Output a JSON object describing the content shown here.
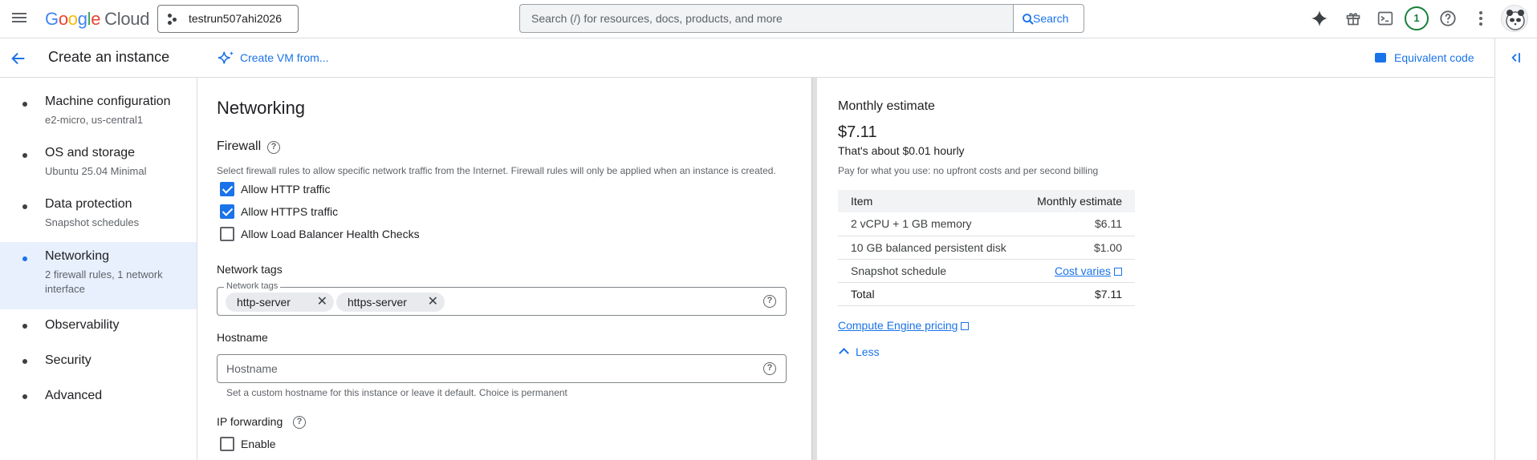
{
  "topbar": {
    "logo": {
      "g1": "G",
      "o1": "o",
      "o2": "o",
      "g2": "g",
      "l": "l",
      "e": "e",
      "cloud": "Cloud"
    },
    "project": "testrun507ahi2026",
    "search_placeholder": "Search (/) for resources, docs, products, and more",
    "search_button": "Search",
    "notification_count": "1",
    "icons": [
      "menu-icon",
      "gemini-spark-icon",
      "gift-icon",
      "cloud-shell-icon",
      "help-icon",
      "more-vert-icon"
    ]
  },
  "header": {
    "title": "Create an instance",
    "create_vm": "Create VM from...",
    "equivalent_code": "Equivalent code"
  },
  "nav": {
    "items": [
      {
        "title": "Machine configuration",
        "sub": "e2-micro, us-central1"
      },
      {
        "title": "OS and storage",
        "sub": "Ubuntu 25.04 Minimal"
      },
      {
        "title": "Data protection",
        "sub": "Snapshot schedules"
      },
      {
        "title": "Networking",
        "sub": "2 firewall rules, 1 network interface",
        "active": true
      },
      {
        "title": "Observability"
      },
      {
        "title": "Security"
      },
      {
        "title": "Advanced"
      }
    ]
  },
  "main": {
    "section_title": "Networking",
    "firewall": {
      "title": "Firewall",
      "description": "Select firewall rules to allow specific network traffic from the Internet. Firewall rules will only be applied when an instance is created.",
      "options": [
        {
          "label": "Allow HTTP traffic",
          "checked": true
        },
        {
          "label": "Allow HTTPS traffic",
          "checked": true
        },
        {
          "label": "Allow Load Balancer Health Checks",
          "checked": false
        }
      ]
    },
    "network_tags": {
      "title": "Network tags",
      "field_label": "Network tags",
      "chips": [
        "http-server",
        "https-server"
      ]
    },
    "hostname": {
      "title": "Hostname",
      "placeholder": "Hostname",
      "hint": "Set a custom hostname for this instance or leave it default. Choice is permanent"
    },
    "ip_forwarding": {
      "title": "IP forwarding",
      "option": {
        "label": "Enable",
        "checked": false
      }
    }
  },
  "estimate": {
    "title": "Monthly estimate",
    "price": "$7.11",
    "hourly": "That's about $0.01 hourly",
    "note": "Pay for what you use: no upfront costs and per second billing",
    "columns": [
      "Item",
      "Monthly estimate"
    ],
    "rows": [
      {
        "item": "2 vCPU + 1 GB memory",
        "value": "$6.11"
      },
      {
        "item": "10 GB balanced persistent disk",
        "value": "$1.00"
      },
      {
        "item": "Snapshot schedule",
        "value": "Cost varies",
        "link": true
      },
      {
        "item": "Total",
        "value": "$7.11",
        "total": true
      }
    ],
    "pricing_link": "Compute Engine pricing",
    "less": "Less"
  },
  "colors": {
    "accent": "#1a73e8",
    "active_nav": "#e8f0fe",
    "badge_green": "#188038"
  }
}
